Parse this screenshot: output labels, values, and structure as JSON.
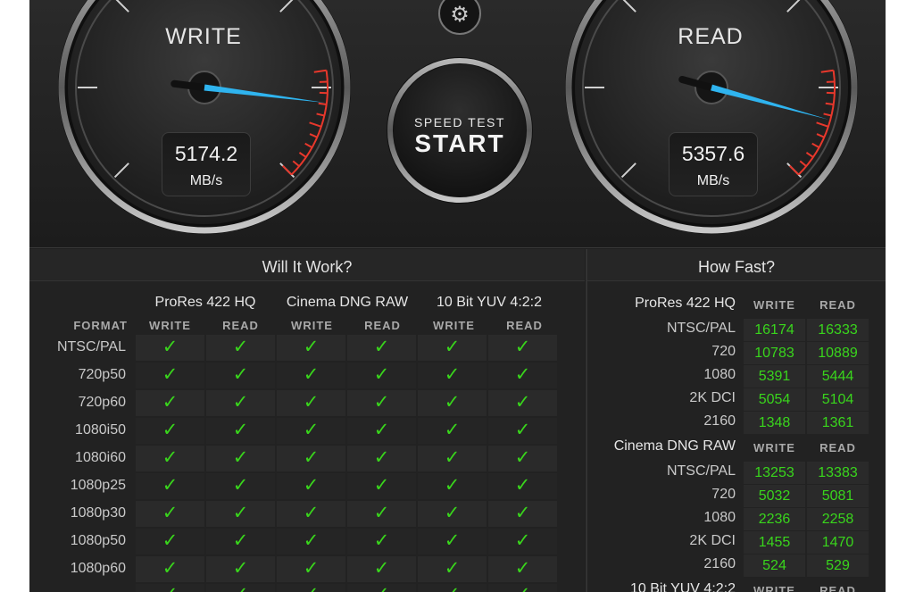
{
  "gauges": {
    "write": {
      "title": "WRITE",
      "value": "5174.2",
      "unit": "MB/s",
      "level": 0.86
    },
    "read": {
      "title": "READ",
      "value": "5357.6",
      "unit": "MB/s",
      "level": 0.89
    }
  },
  "start": {
    "top_label": "SPEED TEST",
    "label": "START"
  },
  "settings_icon": "gear-icon",
  "will_it_work": {
    "title": "Will It Work?",
    "format_header": "FORMAT",
    "groups": [
      "ProRes 422 HQ",
      "Cinema DNG RAW",
      "10 Bit YUV 4:2:2"
    ],
    "sub_headers": [
      "WRITE",
      "READ"
    ],
    "check_glyph": "✓",
    "rows": [
      "NTSC/PAL",
      "720p50",
      "720p60",
      "1080i50",
      "1080i60",
      "1080p25",
      "1080p30",
      "1080p50",
      "1080p60"
    ]
  },
  "how_fast": {
    "title": "How Fast?",
    "sub_headers": [
      "WRITE",
      "READ"
    ],
    "groups": [
      {
        "name": "ProRes 422 HQ",
        "rows": [
          {
            "label": "NTSC/PAL",
            "write": "16174",
            "read": "16333"
          },
          {
            "label": "720",
            "write": "10783",
            "read": "10889"
          },
          {
            "label": "1080",
            "write": "5391",
            "read": "5444"
          },
          {
            "label": "2K DCI",
            "write": "5054",
            "read": "5104"
          },
          {
            "label": "2160",
            "write": "1348",
            "read": "1361"
          }
        ]
      },
      {
        "name": "Cinema DNG RAW",
        "rows": [
          {
            "label": "NTSC/PAL",
            "write": "13253",
            "read": "13383"
          },
          {
            "label": "720",
            "write": "5032",
            "read": "5081"
          },
          {
            "label": "1080",
            "write": "2236",
            "read": "2258"
          },
          {
            "label": "2K DCI",
            "write": "1455",
            "read": "1470"
          },
          {
            "label": "2160",
            "write": "524",
            "read": "529"
          }
        ]
      },
      {
        "name": "10 Bit YUV 4:2:2",
        "rows": []
      }
    ]
  },
  "colors": {
    "accent_needle": "#2fb4ef",
    "check_green": "#39d51c",
    "redline": "#e8382c"
  }
}
